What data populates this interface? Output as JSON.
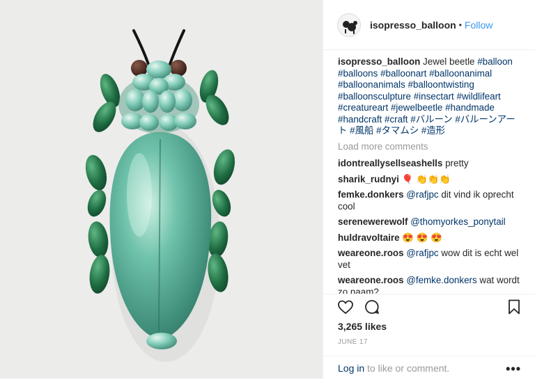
{
  "post": {
    "username": "isopresso_balloon",
    "follow_label": "Follow",
    "dot": "•",
    "caption": {
      "username": "isopresso_balloon",
      "text": "Jewel beetle",
      "hashtags": [
        "#balloon",
        "#balloons",
        "#balloonart",
        "#balloonanimal",
        "#balloonanimals",
        "#balloontwisting",
        "#balloonsculpture",
        "#insectart",
        "#wildlifeart",
        "#creatureart",
        "#jewelbeetle",
        "#handmade",
        "#handcraft",
        "#craft",
        "#バルーン",
        "#バルーンアート",
        "#風船",
        "#タマムシ",
        "#造形"
      ]
    },
    "load_more": "Load more comments",
    "comments": [
      {
        "user": "idontreallysellseashells",
        "text": "pretty"
      },
      {
        "user": "sharik_rudnyi",
        "text": "🎈 👏👏👏"
      },
      {
        "user": "femke.donkers",
        "mention": "@rafjpc",
        "text": "dit vind ik oprecht cool"
      },
      {
        "user": "serenewerewolf",
        "mention": "@thomyorkes_ponytail",
        "text": ""
      },
      {
        "user": "huldravoltaire",
        "text": "😍 😍 😍"
      },
      {
        "user": "weareone.roos",
        "mention": "@rafjpc",
        "text": "wow dit is echt wel vet"
      },
      {
        "user": "weareone.roos",
        "mention": "@femke.donkers",
        "text": "wat wordt zo naam?"
      }
    ],
    "likes": "3,265 likes",
    "date": "JUNE 17",
    "login_link": "Log in",
    "login_rest": " to like or comment.",
    "more_label": "•••",
    "icons": [
      "heart-icon",
      "comment-icon",
      "bookmark-icon",
      "more-icon"
    ]
  }
}
